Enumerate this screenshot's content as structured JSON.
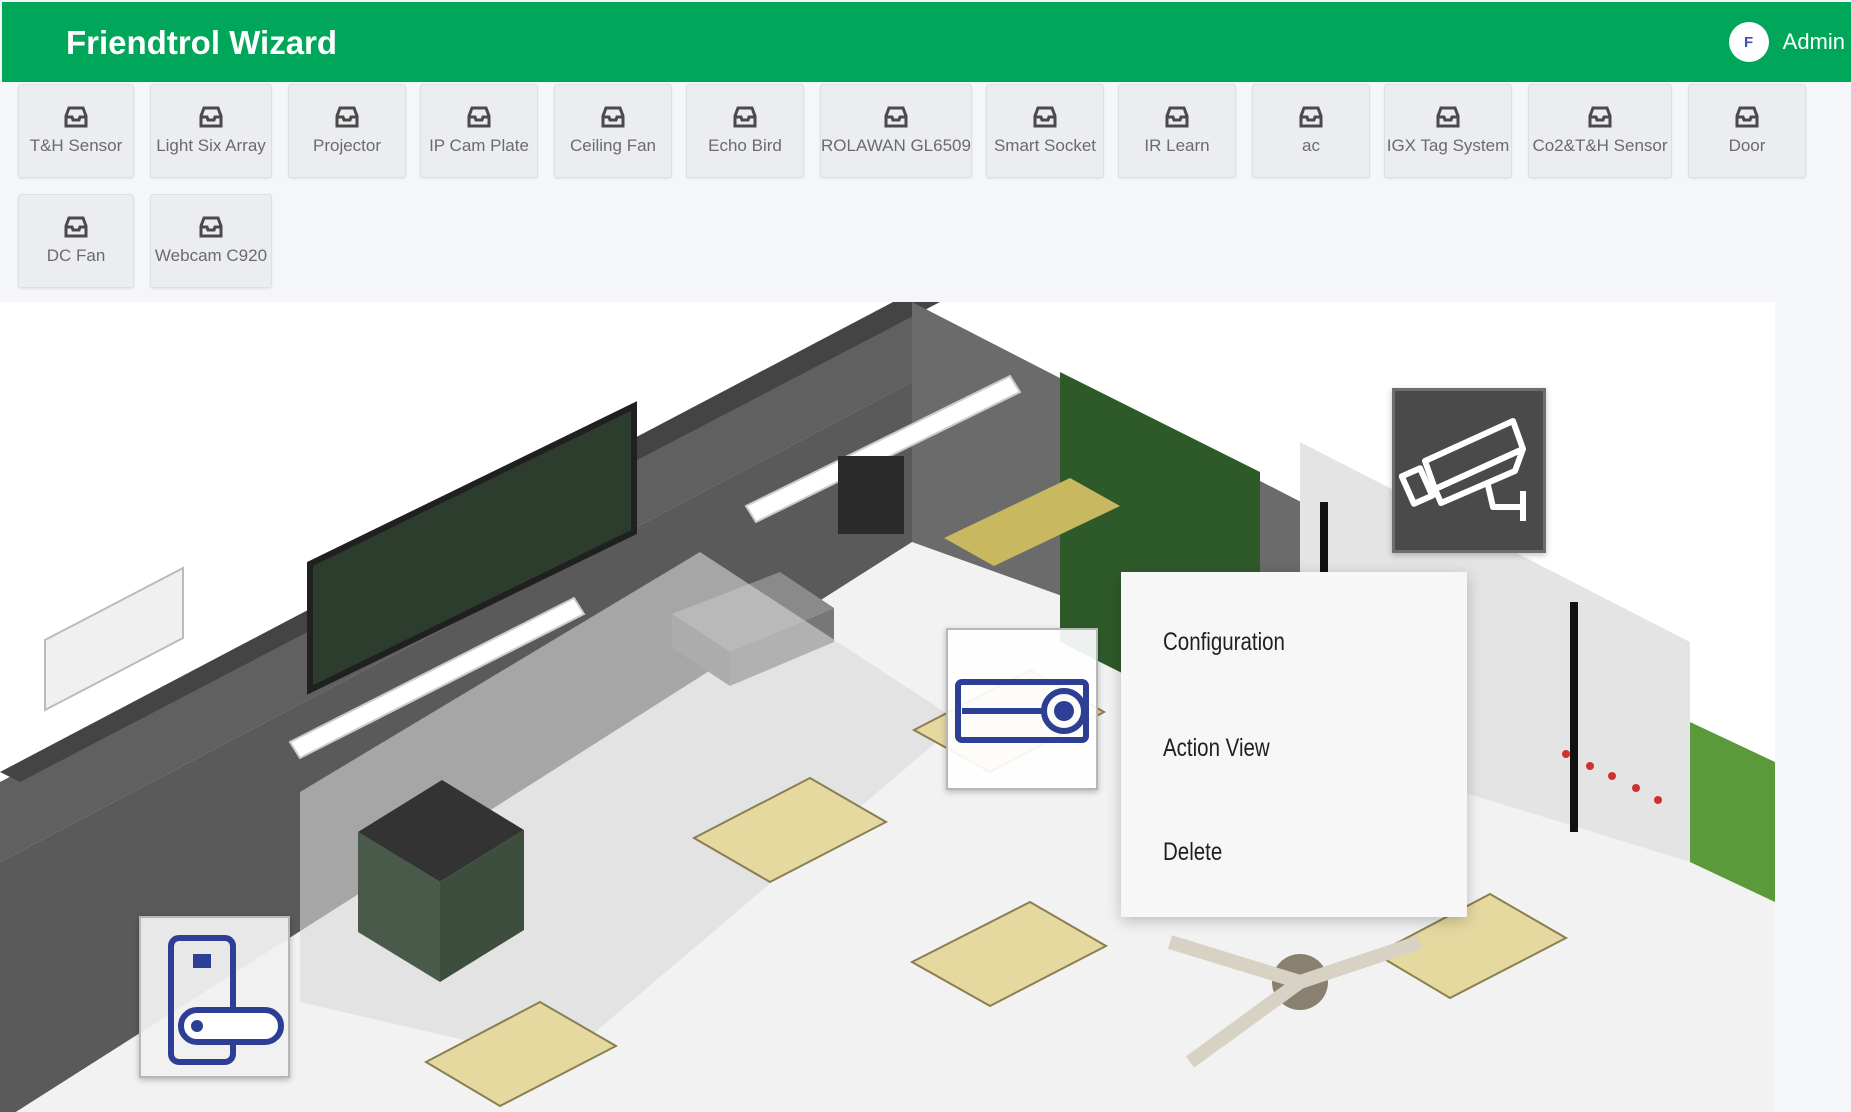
{
  "header": {
    "title": "Friendtrol Wizard",
    "avatar_letter": "F",
    "user_name": "Admin",
    "color": "#00a65a"
  },
  "devices": [
    {
      "label": "T&H Sensor",
      "icon": "tray-icon"
    },
    {
      "label": "Light Six Array",
      "icon": "tray-icon"
    },
    {
      "label": "Projector",
      "icon": "tray-icon"
    },
    {
      "label": "IP Cam Plate",
      "icon": "tray-icon"
    },
    {
      "label": "Ceiling Fan",
      "icon": "tray-icon"
    },
    {
      "label": "Echo Bird",
      "icon": "tray-icon"
    },
    {
      "label": "ROLAWAN GL6509",
      "icon": "tray-icon"
    },
    {
      "label": "Smart Socket",
      "icon": "tray-icon"
    },
    {
      "label": "IR Learn",
      "icon": "tray-icon"
    },
    {
      "label": "ac",
      "icon": "tray-icon"
    },
    {
      "label": "IGX Tag System",
      "icon": "tray-icon"
    },
    {
      "label": "Co2&T&H Sensor",
      "icon": "tray-icon"
    },
    {
      "label": "Door",
      "icon": "tray-icon"
    },
    {
      "label": "DC Fan",
      "icon": "tray-icon"
    },
    {
      "label": "Webcam C920",
      "icon": "tray-icon"
    }
  ],
  "scene": {
    "markers": [
      {
        "name": "camera-marker",
        "icon": "security-camera-icon"
      },
      {
        "name": "projector-marker",
        "icon": "projector-icon"
      },
      {
        "name": "door-lock-marker",
        "icon": "door-lock-icon"
      }
    ]
  },
  "context_menu": {
    "items": [
      "Configuration",
      "Action View",
      "Delete"
    ]
  }
}
